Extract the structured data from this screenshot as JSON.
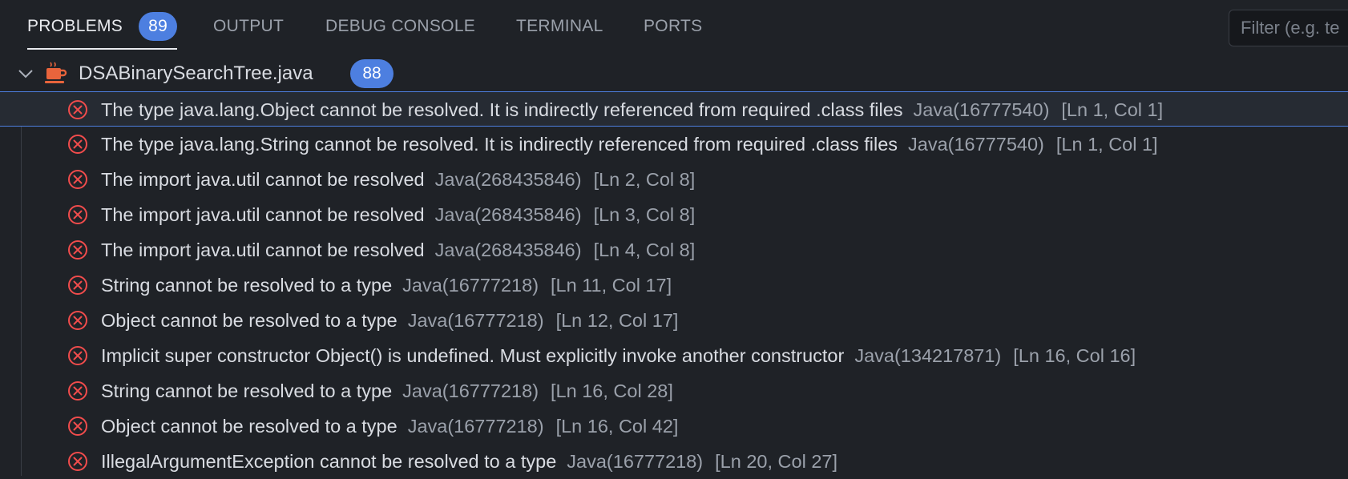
{
  "tabs": [
    {
      "label": "PROBLEMS",
      "badge": "89",
      "active": true
    },
    {
      "label": "OUTPUT"
    },
    {
      "label": "DEBUG CONSOLE"
    },
    {
      "label": "TERMINAL"
    },
    {
      "label": "PORTS"
    }
  ],
  "filter": {
    "placeholder": "Filter (e.g. te"
  },
  "file": {
    "name": "DSABinarySearchTree.java",
    "count": "88"
  },
  "problems": [
    {
      "message": "The type java.lang.Object cannot be resolved. It is indirectly referenced from required .class files",
      "source": "Java(16777540)",
      "location": "[Ln 1, Col 1]"
    },
    {
      "message": "The type java.lang.String cannot be resolved. It is indirectly referenced from required .class files",
      "source": "Java(16777540)",
      "location": "[Ln 1, Col 1]"
    },
    {
      "message": "The import java.util cannot be resolved",
      "source": "Java(268435846)",
      "location": "[Ln 2, Col 8]"
    },
    {
      "message": "The import java.util cannot be resolved",
      "source": "Java(268435846)",
      "location": "[Ln 3, Col 8]"
    },
    {
      "message": "The import java.util cannot be resolved",
      "source": "Java(268435846)",
      "location": "[Ln 4, Col 8]"
    },
    {
      "message": "String cannot be resolved to a type",
      "source": "Java(16777218)",
      "location": "[Ln 11, Col 17]"
    },
    {
      "message": "Object cannot be resolved to a type",
      "source": "Java(16777218)",
      "location": "[Ln 12, Col 17]"
    },
    {
      "message": "Implicit super constructor Object() is undefined. Must explicitly invoke another constructor",
      "source": "Java(134217871)",
      "location": "[Ln 16, Col 16]"
    },
    {
      "message": "String cannot be resolved to a type",
      "source": "Java(16777218)",
      "location": "[Ln 16, Col 28]"
    },
    {
      "message": "Object cannot be resolved to a type",
      "source": "Java(16777218)",
      "location": "[Ln 16, Col 42]"
    },
    {
      "message": "IllegalArgumentException cannot be resolved to a type",
      "source": "Java(16777218)",
      "location": "[Ln 20, Col 27]"
    }
  ],
  "colors": {
    "error": "#f14c4c",
    "accent": "#4d7fe0",
    "java_icon": "#e8643c"
  }
}
